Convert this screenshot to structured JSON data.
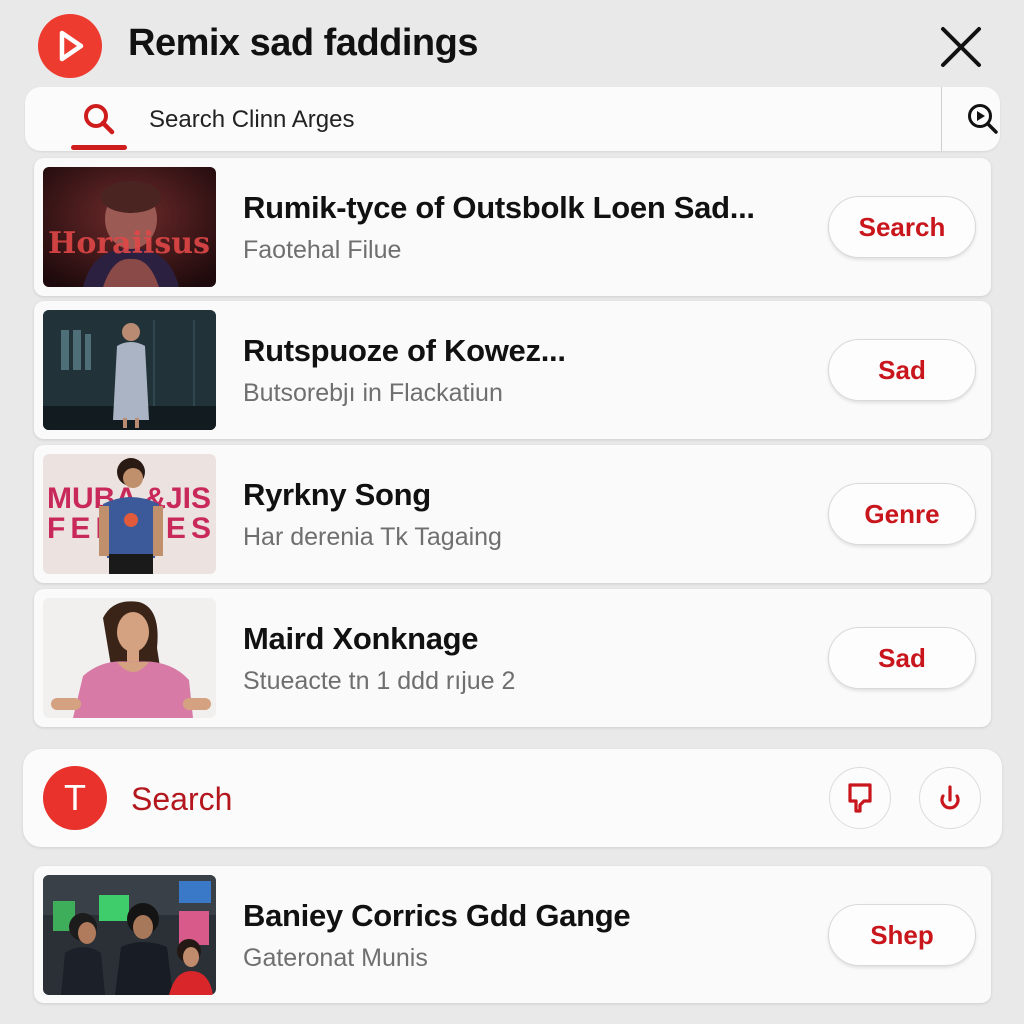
{
  "header": {
    "title": "Remix sad faddings",
    "logo_icon": "play-icon",
    "close_icon": "close-icon"
  },
  "search": {
    "placeholder": "Search Clinn Arges",
    "value": "",
    "search_icon": "search-icon",
    "lens_icon": "video-search-icon"
  },
  "results": [
    {
      "title": "Rumik-tyce of Outsbolk Loen Sad...",
      "subtitle": "Faotehal Filue",
      "button_label": "Search",
      "thumbnail_text": "Horaiisus"
    },
    {
      "title": "Rutspuoze of Kowez...",
      "subtitle": "Butsorebjı in Flackatiun",
      "button_label": "Sad",
      "thumbnail_text": ""
    },
    {
      "title": "Ryrkny Song",
      "subtitle": "Har derenia Tk Tagaing",
      "button_label": "Genre",
      "thumbnail_text": "MUBA &JIS FEM NES"
    },
    {
      "title": "Maird Xonknage",
      "subtitle": "Stueacte tn 1 ddd rıjue 2",
      "button_label": "Sad",
      "thumbnail_text": ""
    }
  ],
  "action_bar": {
    "avatar_letter": "T",
    "label": "Search",
    "buttons": [
      {
        "icon": "thumbs-down-icon"
      },
      {
        "icon": "power-icon"
      }
    ]
  },
  "bottom_result": {
    "title": "Baniey Corrics Gdd Gange",
    "subtitle": "Gateronat Munis",
    "button_label": "Shep"
  },
  "colors": {
    "accent": "#e8322b",
    "accent_text": "#c8161c",
    "background": "#e9e9e9",
    "card": "#fafafa"
  }
}
